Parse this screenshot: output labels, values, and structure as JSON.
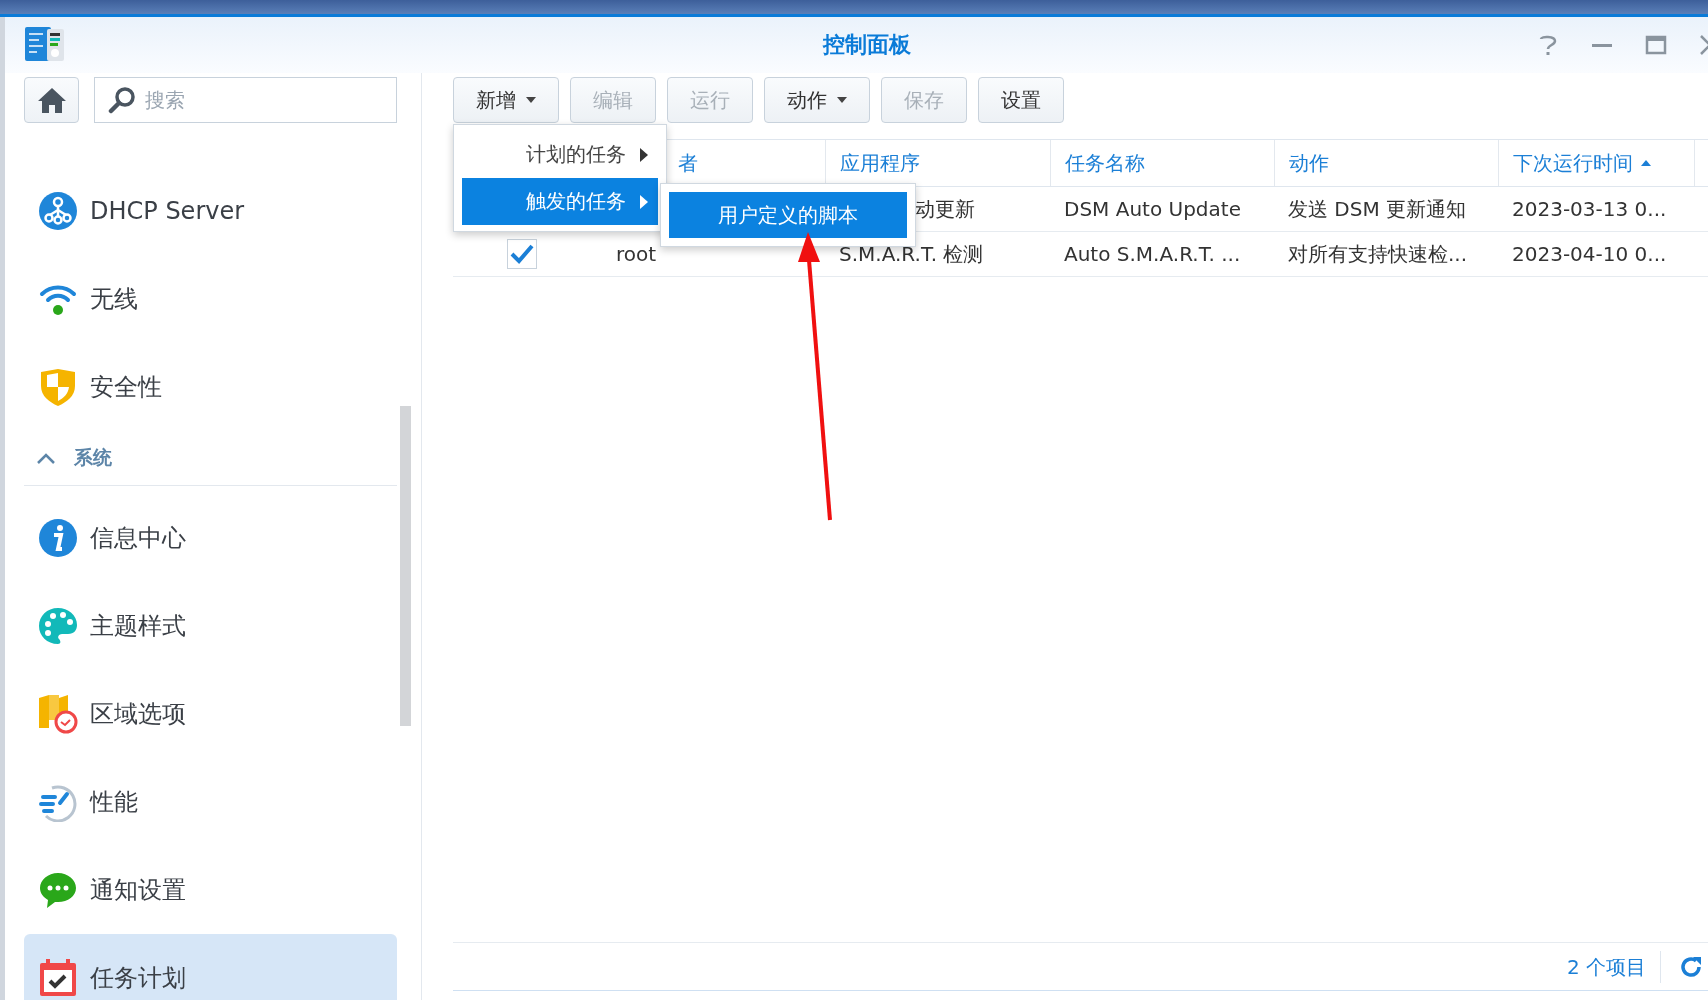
{
  "window": {
    "title": "控制面板"
  },
  "sidebar": {
    "search": {
      "placeholder": "搜索"
    },
    "items": [
      {
        "kind": "item",
        "label": "DHCP Server",
        "selected": false
      },
      {
        "kind": "item",
        "label": "无线",
        "selected": false
      },
      {
        "kind": "item",
        "label": "安全性",
        "selected": false
      },
      {
        "kind": "section",
        "label": "系统",
        "expanded": true
      },
      {
        "kind": "item",
        "label": "信息中心",
        "selected": false
      },
      {
        "kind": "item",
        "label": "主题样式",
        "selected": false
      },
      {
        "kind": "item",
        "label": "区域选项",
        "selected": false
      },
      {
        "kind": "item",
        "label": "性能",
        "selected": false
      },
      {
        "kind": "item",
        "label": "通知设置",
        "selected": false
      },
      {
        "kind": "item",
        "label": "任务计划",
        "selected": true
      }
    ]
  },
  "toolbar": [
    {
      "label": "新增",
      "dropdown": true,
      "disabled": false
    },
    {
      "label": "编辑",
      "dropdown": false,
      "disabled": true
    },
    {
      "label": "运行",
      "dropdown": false,
      "disabled": true
    },
    {
      "label": "动作",
      "dropdown": true,
      "disabled": false
    },
    {
      "label": "保存",
      "dropdown": false,
      "disabled": true
    },
    {
      "label": "设置",
      "dropdown": false,
      "disabled": false
    }
  ],
  "table": {
    "columns": [
      {
        "label": "者",
        "sorted": false
      },
      {
        "label": "应用程序",
        "sorted": false
      },
      {
        "label": "任务名称",
        "sorted": false
      },
      {
        "label": "动作",
        "sorted": false
      },
      {
        "label": "下次运行时间",
        "sorted": true
      }
    ],
    "rows": [
      {
        "cells": [
          null,
          "动更新",
          "DSM Auto Update",
          "发送 DSM 更新通知",
          "2023-03-13 0..."
        ]
      },
      {
        "checked": true,
        "cells": [
          "root",
          "S.M.A.R.T. 检测",
          "Auto S.M.A.R.T. ...",
          "对所有支持快速检...",
          "2023-04-10 0..."
        ]
      }
    ]
  },
  "menu": {
    "items": [
      {
        "label": "计划的任务",
        "selected": false
      },
      {
        "label": "触发的任务",
        "selected": true
      }
    ],
    "submenu": {
      "items": [
        {
          "label": "用户定义的脚本",
          "selected": true
        }
      ]
    }
  },
  "status_bar": {
    "count": "2 个项目"
  }
}
